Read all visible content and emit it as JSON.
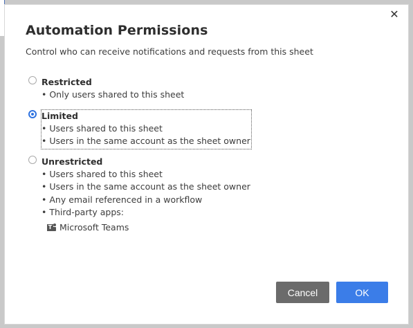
{
  "dialog": {
    "title": "Automation Permissions",
    "subtitle": "Control who can receive notifications and requests from this sheet",
    "close_glyph": "✕",
    "close_icon": "close-icon"
  },
  "options": [
    {
      "label": "Restricted",
      "checked": false,
      "bullets": [
        "• Only users shared to this sheet"
      ]
    },
    {
      "label": "Limited",
      "checked": true,
      "bullets": [
        "• Users shared to this sheet",
        "• Users in the same account as the sheet owner"
      ]
    },
    {
      "label": "Unrestricted",
      "checked": false,
      "bullets": [
        "• Users shared to this sheet",
        "• Users in the same account as the sheet owner",
        "• Any email referenced in a workflow",
        "• Third-party apps:"
      ],
      "apps": [
        {
          "icon": "microsoft-teams-icon",
          "icon_letter": "T",
          "name": "Microsoft Teams"
        }
      ]
    }
  ],
  "buttons": {
    "cancel": "Cancel",
    "ok": "OK"
  },
  "colors": {
    "accent": "#3b7de8",
    "cancel": "#6b6b6b",
    "radio_checked": "#2f73e0"
  }
}
